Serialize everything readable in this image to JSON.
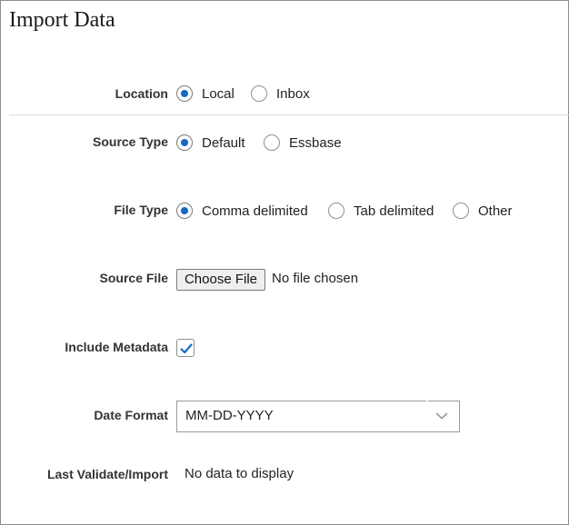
{
  "title": "Import Data",
  "location": {
    "label": "Location",
    "options": [
      "Local",
      "Inbox"
    ],
    "selected": "Local"
  },
  "source_type": {
    "label": "Source Type",
    "options": [
      "Default",
      "Essbase"
    ],
    "selected": "Default"
  },
  "file_type": {
    "label": "File Type",
    "options": [
      "Comma delimited",
      "Tab delimited",
      "Other"
    ],
    "selected": "Comma delimited"
  },
  "source_file": {
    "label": "Source File",
    "button_label": "Choose File",
    "status": "No file chosen"
  },
  "include_metadata": {
    "label": "Include Metadata",
    "checked": true
  },
  "date_format": {
    "label": "Date Format",
    "value": "MM-DD-YYYY"
  },
  "last_validate": {
    "label": "Last Validate/Import",
    "value": "No data to display"
  },
  "colors": {
    "accent": "#1668c4",
    "border": "#8f8f8f",
    "divider": "#dcdcdc"
  },
  "icons": {
    "checkbox_mark": "checkmark-icon",
    "select_arrow": "chevron-down-icon"
  }
}
